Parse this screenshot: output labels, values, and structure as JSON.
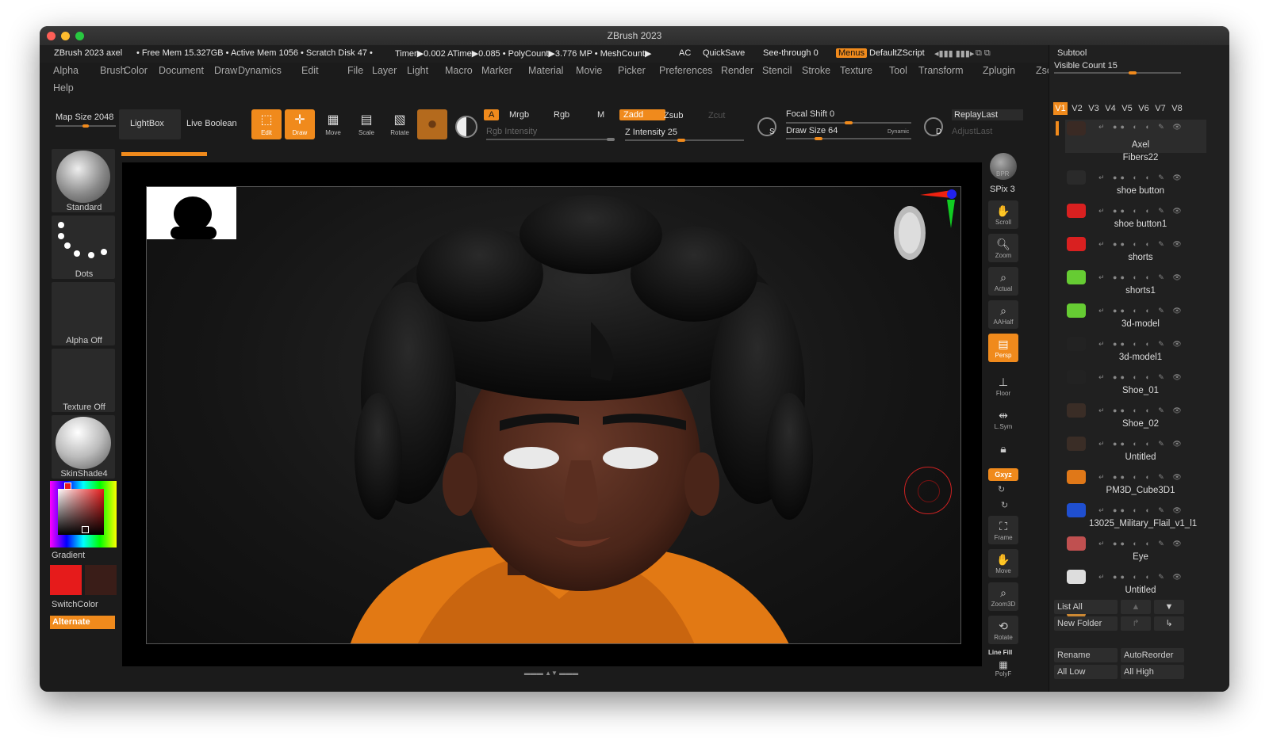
{
  "window": {
    "title": "ZBrush 2023"
  },
  "status": {
    "app": "ZBrush 2023 axel",
    "mem": "• Free Mem 15.327GB • Active Mem 1056 • Scratch Disk 47 •",
    "timer": "Timer▶0.002 ATime▶0.085 • PolyCount▶3.776 MP • MeshCount▶",
    "ac": "AC",
    "quicksave": "QuickSave",
    "seethrough": "See-through  0",
    "menus": "Menus",
    "script": "DefaultZScript"
  },
  "menubar": [
    "Alpha",
    "Brush",
    "Color",
    "Document",
    "Draw",
    "Dynamics",
    "Edit",
    "File",
    "Layer",
    "Light",
    "Macro",
    "Marker",
    "Material",
    "Movie",
    "Picker",
    "Preferences",
    "Render",
    "Stencil",
    "Stroke",
    "Texture",
    "Tool",
    "Transform",
    "Zplugin",
    "Zscript",
    "Help"
  ],
  "toolbar": {
    "mapsize": "Map Size 2048",
    "lightbox": "LightBox",
    "liveboolean": "Live Boolean",
    "edit": "Edit",
    "draw": "Draw",
    "move": "Move",
    "scale": "Scale",
    "rotate": "Rotate",
    "a": "A",
    "mrgb": "Mrgb",
    "rgb": "Rgb",
    "m": "M",
    "rgb_intensity": "Rgb Intensity",
    "zadd": "Zadd",
    "zsub": "Zsub",
    "zcut": "Zcut",
    "z_intensity": "Z Intensity 25",
    "focal_shift": "Focal Shift 0",
    "draw_size": "Draw Size 64",
    "dynamic": "Dynamic",
    "replaylast": "ReplayLast",
    "adjustlast": "AdjustLast",
    "s": "S",
    "d": "D"
  },
  "leftshelf": {
    "brush": "Standard",
    "stroke": "Dots",
    "alpha": "Alpha Off",
    "texture": "Texture Off",
    "material": "SkinShade4",
    "gradient": "Gradient",
    "switchcolor": "SwitchColor",
    "alternate": "Alternate",
    "main_color": "#e61b1b",
    "secondary_color": "#3a1d18"
  },
  "rightshelf": {
    "bpr": "BPR",
    "spix": "SPix 3",
    "scroll": "Scroll",
    "zoom": "Zoom",
    "actual": "Actual",
    "aahalf": "AAHalf",
    "persp": "Persp",
    "floor": "Floor",
    "lsym": "L.Sym",
    "xyz": "Gxyz",
    "frame": "Frame",
    "move": "Move",
    "zoom3d": "Zoom3D",
    "rotate": "Rotate",
    "linefill": "Line Fill",
    "polyf": "PolyF"
  },
  "subtool": {
    "title": "Subtool",
    "visible_count": "Visible Count 15",
    "versions": [
      "V1",
      "V2",
      "V3",
      "V4",
      "V5",
      "V6",
      "V7",
      "V8"
    ],
    "items": [
      {
        "name": "Axel",
        "color": "#3a2a24"
      },
      {
        "name": "Fibers22",
        "color": "#2a2a2a"
      },
      {
        "name": "shoe button",
        "color": "#d92020"
      },
      {
        "name": "shoe button1",
        "color": "#d92020"
      },
      {
        "name": "shorts",
        "color": "#66cc33"
      },
      {
        "name": "shorts1",
        "color": "#66cc33"
      },
      {
        "name": "3d-model",
        "color": "#222222"
      },
      {
        "name": "3d-model1",
        "color": "#222222"
      },
      {
        "name": "Shoe_01",
        "color": "#3a2d26"
      },
      {
        "name": "Shoe_02",
        "color": "#3a2d26"
      },
      {
        "name": "Untitled",
        "color": "#e07818"
      },
      {
        "name": "PM3D_Cube3D1",
        "color": "#1f4fd0"
      },
      {
        "name": "13025_Military_Flail_v1_l1",
        "color": "#c05050"
      },
      {
        "name": "Eye",
        "color": "#dddddd"
      },
      {
        "name": "Untitled",
        "color": "#cc8833"
      }
    ],
    "list_all": "List All",
    "new_folder": "New Folder",
    "rename": "Rename",
    "autoreorder": "AutoReorder",
    "all_low": "All Low",
    "all_high": "All High"
  }
}
